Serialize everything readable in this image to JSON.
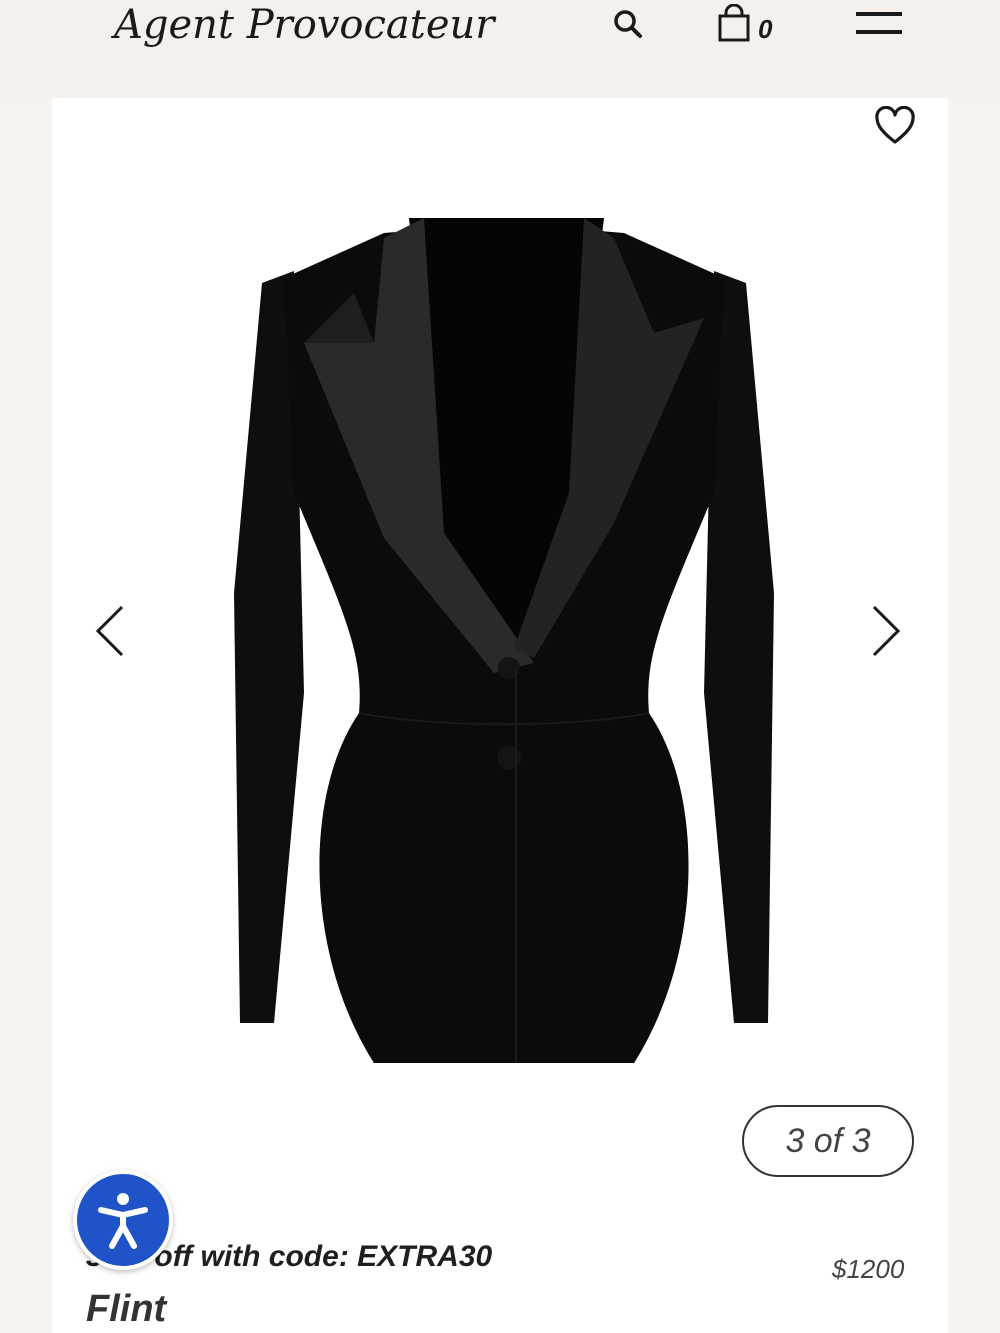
{
  "header": {
    "logo_text": "Agent Provocateur",
    "cart_count": "0",
    "icons": [
      "search-icon",
      "bag-icon",
      "menu-icon"
    ]
  },
  "gallery": {
    "counter": "3 of 3",
    "image_alt_icon": "blazer-image",
    "icons": [
      "heart-icon",
      "chevron-left-icon",
      "chevron-right-icon"
    ]
  },
  "product": {
    "promo": "30% off with code: EXTRA30",
    "price": "$1200",
    "name": "Flint"
  },
  "accessibility": {
    "icon": "accessibility-icon"
  },
  "colors": {
    "header_bg": "#f5f0eb",
    "accessibility_blue": "#1f53c7",
    "garment_black": "#0b0b0c"
  }
}
